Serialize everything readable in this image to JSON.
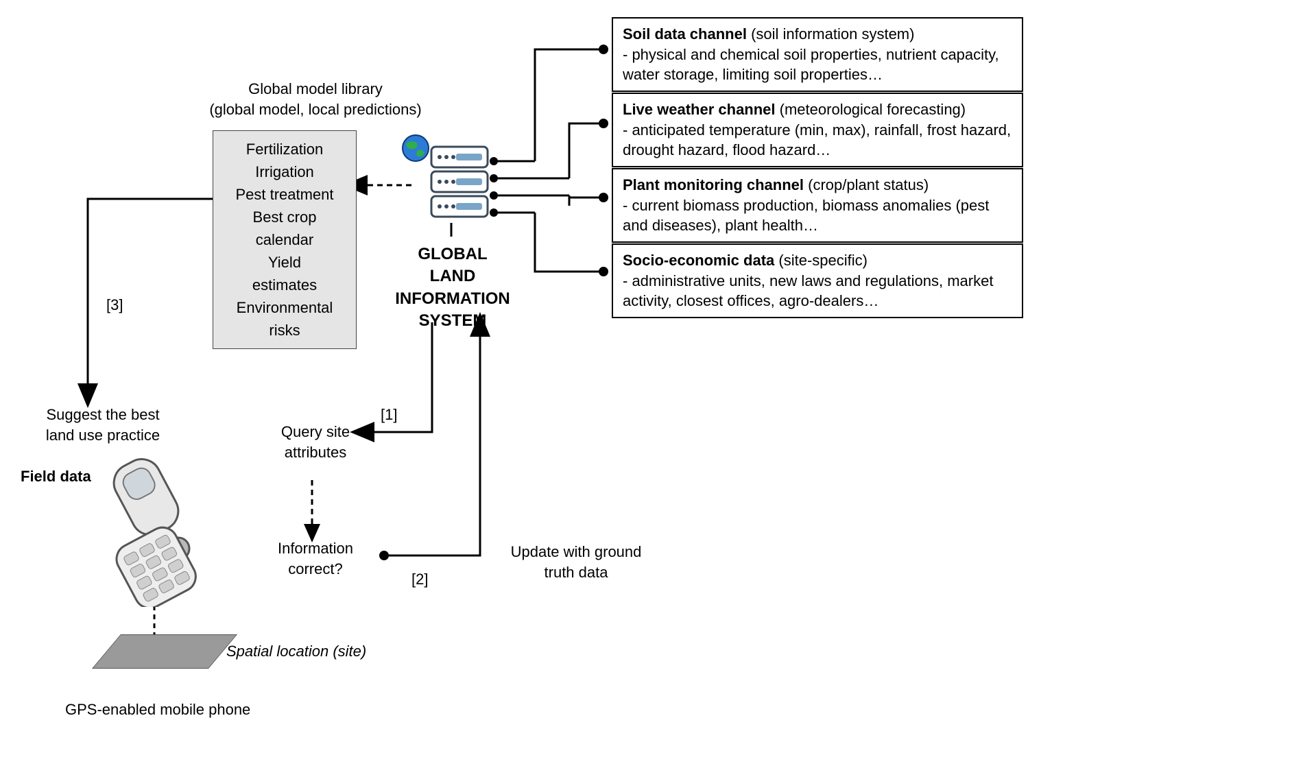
{
  "header": {
    "library_title_l1": "Global model library",
    "library_title_l2": "(global model, local predictions)"
  },
  "model_box": {
    "items": [
      "Fertilization",
      "Irrigation",
      "Pest treatment",
      "Best crop calendar",
      "Yield estimates",
      "Environmental risks"
    ]
  },
  "glis": {
    "l1": "GLOBAL",
    "l2": "LAND INFORMATION",
    "l3": "SYSTEM"
  },
  "channels": [
    {
      "title": "Soil data channel",
      "paren": "(soil information system)",
      "body": "- physical and chemical soil properties, nutrient capacity, water storage, limiting soil properties…"
    },
    {
      "title": "Live weather channel",
      "paren": "(meteorological forecasting)",
      "body": "- anticipated temperature (min, max), rainfall, frost hazard, drought hazard, flood hazard…"
    },
    {
      "title": "Plant monitoring channel",
      "paren": "(crop/plant status)",
      "body": "- current biomass production, biomass anomalies (pest and diseases), plant health…"
    },
    {
      "title": "Socio-economic data",
      "paren": "(site-specific)",
      "body": "- administrative units, new laws and regulations, market activity, closest offices, agro-dealers…"
    }
  ],
  "flow": {
    "step3": "[3]",
    "suggest_l1": "Suggest the best",
    "suggest_l2": "land use practice",
    "field_data": "Field data",
    "gps_caption": "GPS-enabled mobile phone",
    "spatial": "Spatial location (site)",
    "step1": "[1]",
    "query_l1": "Query site",
    "query_l2": "attributes",
    "info_l1": "Information",
    "info_l2": "correct?",
    "step2": "[2]",
    "update_l1": "Update with ground",
    "update_l2": "truth data"
  }
}
